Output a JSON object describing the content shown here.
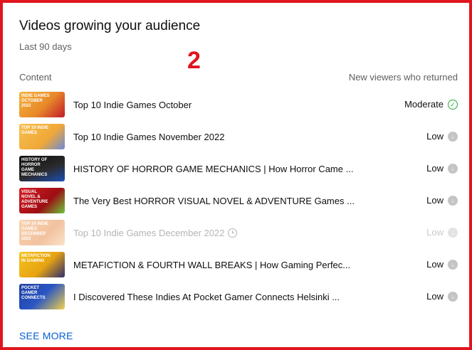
{
  "card": {
    "title": "Videos growing your audience",
    "subtitle": "Last 90 days",
    "annotation": "2",
    "column_left": "Content",
    "column_right": "New viewers who returned",
    "see_more": "SEE MORE"
  },
  "colors": {
    "border": "#e0151f",
    "link": "#065fd4",
    "moderate_check": "#2ba640",
    "low_arrow": "#c4c4c4"
  },
  "videos": [
    {
      "title": "Top 10 Indie Games October",
      "metric": "Moderate",
      "metric_icon": "check-circle-icon",
      "thumbnail_bg": "#f0a62a",
      "thumbnail_text": "Indie Games October 2022"
    },
    {
      "title": "Top 10 Indie Games November 2022",
      "metric": "Low",
      "metric_icon": "arrow-down-circle-icon",
      "thumbnail_bg": "#f3b13c",
      "thumbnail_text": "Top 10 Indie Games"
    },
    {
      "title": "HISTORY OF HORROR GAME MECHANICS | How Horror Came ...",
      "metric": "Low",
      "metric_icon": "arrow-down-circle-icon",
      "thumbnail_bg": "#1b1b1b",
      "thumbnail_text": "History of Horror Game Mechanics"
    },
    {
      "title": "The Very Best HORROR VISUAL NOVEL & ADVENTURE Games ...",
      "metric": "Low",
      "metric_icon": "arrow-down-circle-icon",
      "thumbnail_bg": "#c8141b",
      "thumbnail_text": "Visual Novel & Adventure Games"
    },
    {
      "title": "Top 10 Indie Games December 2022",
      "metric": "Low",
      "metric_icon": "arrow-down-circle-icon",
      "thumbnail_bg": "#e8833a",
      "thumbnail_text": "Top 10 Indie Games December 2022",
      "dimmed": true
    },
    {
      "title": "METAFICTION & FOURTH WALL BREAKS | How Gaming Perfec...",
      "metric": "Low",
      "metric_icon": "arrow-down-circle-icon",
      "thumbnail_bg": "#f0b516",
      "thumbnail_text": "Metafiction in Gaming"
    },
    {
      "title": "I Discovered These Indies At Pocket Gamer Connects Helsinki ...",
      "metric": "Low",
      "metric_icon": "arrow-down-circle-icon",
      "thumbnail_bg": "#223a8a",
      "thumbnail_text": "Pocket Gamer Connects"
    }
  ]
}
